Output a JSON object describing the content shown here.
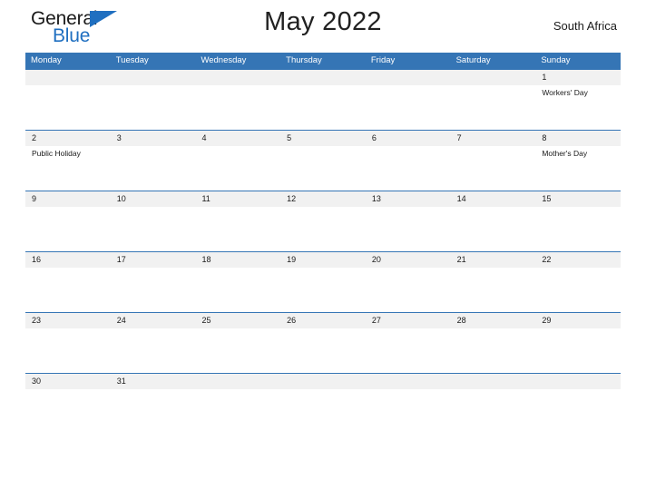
{
  "brand": {
    "word_one": "General",
    "word_two": "Blue",
    "triangle_icon": "triangle-icon",
    "accent_color": "#1f6fc0"
  },
  "header": {
    "title": "May 2022",
    "country": "South Africa"
  },
  "theme": {
    "header_blue": "#3575b5",
    "row_gray": "#f1f1f1",
    "rule_blue": "#3575b5",
    "text_dark": "#1a1a1a"
  },
  "weekdays": [
    "Monday",
    "Tuesday",
    "Wednesday",
    "Thursday",
    "Friday",
    "Saturday",
    "Sunday"
  ],
  "weeks": [
    {
      "days": [
        {
          "num": "",
          "event": ""
        },
        {
          "num": "",
          "event": ""
        },
        {
          "num": "",
          "event": ""
        },
        {
          "num": "",
          "event": ""
        },
        {
          "num": "",
          "event": ""
        },
        {
          "num": "",
          "event": ""
        },
        {
          "num": "1",
          "event": "Workers' Day"
        }
      ]
    },
    {
      "days": [
        {
          "num": "2",
          "event": "Public Holiday"
        },
        {
          "num": "3",
          "event": ""
        },
        {
          "num": "4",
          "event": ""
        },
        {
          "num": "5",
          "event": ""
        },
        {
          "num": "6",
          "event": ""
        },
        {
          "num": "7",
          "event": ""
        },
        {
          "num": "8",
          "event": "Mother's Day"
        }
      ]
    },
    {
      "days": [
        {
          "num": "9",
          "event": ""
        },
        {
          "num": "10",
          "event": ""
        },
        {
          "num": "11",
          "event": ""
        },
        {
          "num": "12",
          "event": ""
        },
        {
          "num": "13",
          "event": ""
        },
        {
          "num": "14",
          "event": ""
        },
        {
          "num": "15",
          "event": ""
        }
      ]
    },
    {
      "days": [
        {
          "num": "16",
          "event": ""
        },
        {
          "num": "17",
          "event": ""
        },
        {
          "num": "18",
          "event": ""
        },
        {
          "num": "19",
          "event": ""
        },
        {
          "num": "20",
          "event": ""
        },
        {
          "num": "21",
          "event": ""
        },
        {
          "num": "22",
          "event": ""
        }
      ]
    },
    {
      "days": [
        {
          "num": "23",
          "event": ""
        },
        {
          "num": "24",
          "event": ""
        },
        {
          "num": "25",
          "event": ""
        },
        {
          "num": "26",
          "event": ""
        },
        {
          "num": "27",
          "event": ""
        },
        {
          "num": "28",
          "event": ""
        },
        {
          "num": "29",
          "event": ""
        }
      ]
    },
    {
      "short": true,
      "days": [
        {
          "num": "30",
          "event": ""
        },
        {
          "num": "31",
          "event": ""
        },
        {
          "num": "",
          "event": ""
        },
        {
          "num": "",
          "event": ""
        },
        {
          "num": "",
          "event": ""
        },
        {
          "num": "",
          "event": ""
        },
        {
          "num": "",
          "event": ""
        }
      ]
    }
  ]
}
